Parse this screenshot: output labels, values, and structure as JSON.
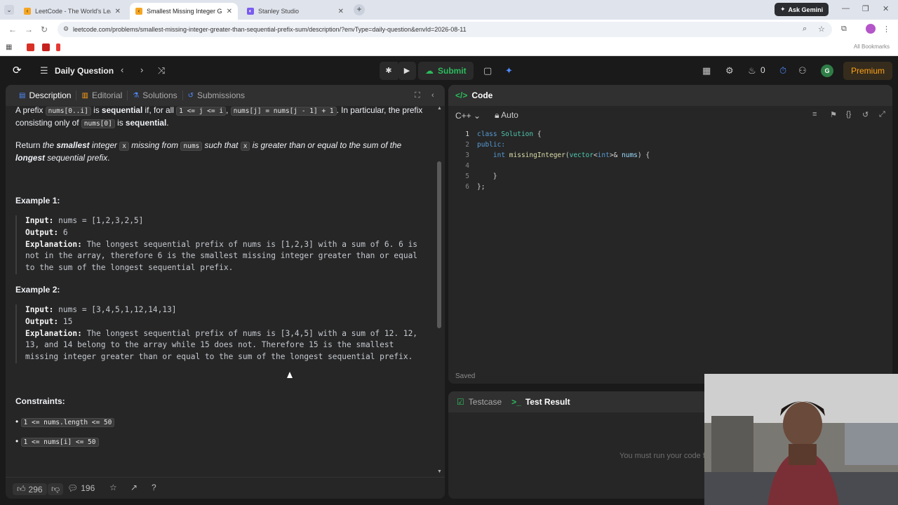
{
  "browser": {
    "tabs": [
      {
        "title": "LeetCode - The World's Leadin",
        "active": false
      },
      {
        "title": "Smallest Missing Integer Great",
        "active": true
      },
      {
        "title": "Stanley Studio",
        "active": false
      }
    ],
    "ask_gemini": "Ask Gemini",
    "url": "leetcode.com/problems/smallest-missing-integer-greater-than-sequential-prefix-sum/description/?envType=daily-question&envId=2026-08-11",
    "all_bookmarks": "All Bookmarks"
  },
  "navbar": {
    "title": "Daily Question",
    "submit": "Submit",
    "streak": "0",
    "avatar_letter": "G",
    "premium": "Premium"
  },
  "left_tabs": {
    "description": "Description",
    "editorial": "Editorial",
    "solutions": "Solutions",
    "submissions": "Submissions"
  },
  "description": {
    "p1": {
      "t1": "A prefix ",
      "c1": "nums[0..i]",
      "t2": " is ",
      "b1": "sequential",
      "t3": " if, for all ",
      "c2": "1 <= j <= i",
      "t4": ", ",
      "c3": "nums[j] = nums[j - 1] + 1",
      "t5": ". In particular, the prefix consisting only of ",
      "c4": "nums[0]",
      "t6": " is ",
      "b2": "sequential",
      "t7": "."
    },
    "p2": {
      "t1": "Return ",
      "i1": "the ",
      "b1": "smallest",
      "i2": " integer ",
      "c1": "x",
      "i3": " missing from ",
      "c2": "nums",
      "i4": " such that ",
      "c3": "x",
      "i5": " is greater than or equal to the sum of the ",
      "b2": "longest",
      "i6": " sequential prefix",
      "t2": "."
    },
    "example1": {
      "heading": "Example 1:",
      "input_label": "Input:",
      "input": " nums = [1,2,3,2,5]",
      "output_label": "Output:",
      "output": " 6",
      "explanation_label": "Explanation:",
      "explanation": " The longest sequential prefix of nums is [1,2,3] with a sum of 6. 6 is not in the array, therefore 6 is the smallest missing integer greater than or equal to the sum of the longest sequential prefix."
    },
    "example2": {
      "heading": "Example 2:",
      "input_label": "Input:",
      "input": " nums = [3,4,5,1,12,14,13]",
      "output_label": "Output:",
      "output": " 15",
      "explanation_label": "Explanation:",
      "explanation": " The longest sequential prefix of nums is [3,4,5] with a sum of 12. 12, 13, and 14 belong to the array while 15 does not. Therefore 15 is the smallest missing integer greater than or equal to the sum of the longest sequential prefix."
    },
    "constraints_heading": "Constraints:",
    "constraints": [
      "1 <= nums.length <= 50",
      "1 <= nums[i] <= 50"
    ]
  },
  "footer": {
    "likes": "296",
    "comments": "196"
  },
  "code_panel": {
    "title": "Code",
    "language": "C++",
    "mode": "Auto",
    "line_numbers": [
      "1",
      "2",
      "3",
      "4",
      "5",
      "6"
    ],
    "lines": {
      "l1a": "class",
      "l1b": "Solution",
      "l1c": " {",
      "l2": "public:",
      "l3a": "int",
      "l3b": "missingInteger",
      "l3c": "(",
      "l3d": "vector",
      "l3e": "<",
      "l3f": "int",
      "l3g": ">& ",
      "l3h": "nums",
      "l3i": ") {",
      "l5": "    }",
      "l6": "};"
    },
    "saved": "Saved"
  },
  "test_panel": {
    "testcase": "Testcase",
    "test_result": "Test Result",
    "message": "You must run your code first"
  },
  "colors": {
    "accent_green": "#2cbb5d",
    "premium_orange": "#ffa116",
    "panel_bg": "#262626",
    "page_bg": "#1a1a1a"
  },
  "icons": {
    "tab_fav_1": "leetcode-icon",
    "tab_fav_3": "stanley-icon"
  }
}
